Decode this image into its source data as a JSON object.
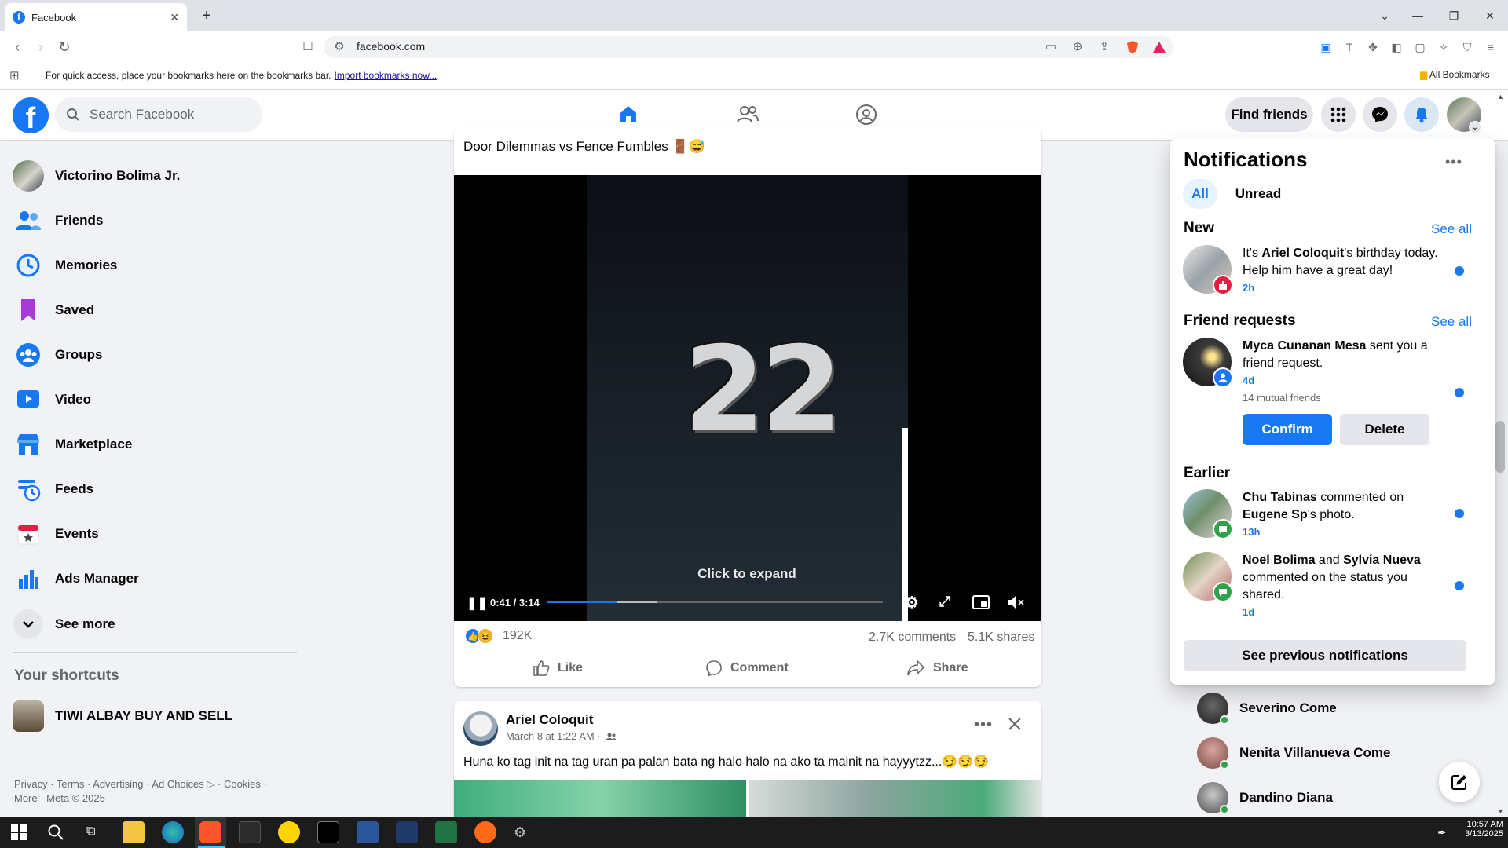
{
  "browser": {
    "tab_title": "Facebook",
    "url": "facebook.com",
    "bookmarks_message": "For quick access, place your bookmarks here on the bookmarks bar.",
    "import_link": "Import bookmarks now...",
    "all_bookmarks": "All Bookmarks"
  },
  "header": {
    "logo": "f",
    "search_placeholder": "Search Facebook",
    "find_friends": "Find friends"
  },
  "sidebar": {
    "profile_name": "Victorino Bolima Jr.",
    "items": [
      {
        "label": "Friends",
        "icon": "friends-icon"
      },
      {
        "label": "Memories",
        "icon": "memories-icon"
      },
      {
        "label": "Saved",
        "icon": "saved-icon"
      },
      {
        "label": "Groups",
        "icon": "groups-icon"
      },
      {
        "label": "Video",
        "icon": "video-icon"
      },
      {
        "label": "Marketplace",
        "icon": "marketplace-icon"
      },
      {
        "label": "Feeds",
        "icon": "feeds-icon"
      },
      {
        "label": "Events",
        "icon": "events-icon"
      },
      {
        "label": "Ads Manager",
        "icon": "ads-manager-icon"
      },
      {
        "label": "See more",
        "icon": "chevron-down-icon"
      }
    ],
    "shortcuts_title": "Your shortcuts",
    "shortcut": "TIWI ALBAY BUY AND SELL",
    "footer_line1": "Privacy · Terms · Advertising · Ad Choices ▷ · Cookies ·",
    "footer_line2": "More · Meta © 2025"
  },
  "post1": {
    "caption": "Door Dilemmas vs Fence Fumbles 🚪😅",
    "video_number": "22",
    "click_to_expand": "Click to expand",
    "time": "0:41 / 3:14",
    "progress": 0.21,
    "buffered": 0.33,
    "reactions_count": "192K",
    "comments": "2.7K comments",
    "shares": "5.1K shares",
    "like": "Like",
    "comment": "Comment",
    "share": "Share"
  },
  "post2": {
    "author": "Ariel Coloquit",
    "date": "March 8 at 1:22 AM ·",
    "text": "Huna ko tag init  na tag  uran  pa palan  bata ng halo halo na ako ta mainit  na hayyytzz...😏😏😏"
  },
  "notifications": {
    "title": "Notifications",
    "tab_all": "All",
    "tab_unread": "Unread",
    "new_title": "New",
    "see_all": "See all",
    "new_item": {
      "name": "Ariel Coloquit",
      "pre": "It's ",
      "post": "'s birthday today. Help him have a great day!",
      "time": "2h"
    },
    "fr_title": "Friend requests",
    "fr_item": {
      "name": "Myca Cunanan Mesa",
      "post": " sent you a friend request.",
      "time": "4d",
      "mutual": "14 mutual friends",
      "confirm": "Confirm",
      "delete": "Delete"
    },
    "earlier_title": "Earlier",
    "earlier1": {
      "name": "Chu Tabinas",
      "mid": " commented on ",
      "name2": "Eugene Sp",
      "post": "'s photo.",
      "time": "13h"
    },
    "earlier2": {
      "name": "Noel Bolima",
      "mid": " and ",
      "name2": "Sylvia Nueva",
      "post": " commented on the status you shared.",
      "time": "1d"
    },
    "see_previous": "See previous notifications"
  },
  "contacts": [
    "Severino Come",
    "Nenita Villanueva Come",
    "Dandino Diana"
  ],
  "taskbar": {
    "time": "10:57 AM",
    "date": "3/13/2025"
  },
  "colors": {
    "brand": "#1877f2",
    "online": "#31a24c"
  }
}
